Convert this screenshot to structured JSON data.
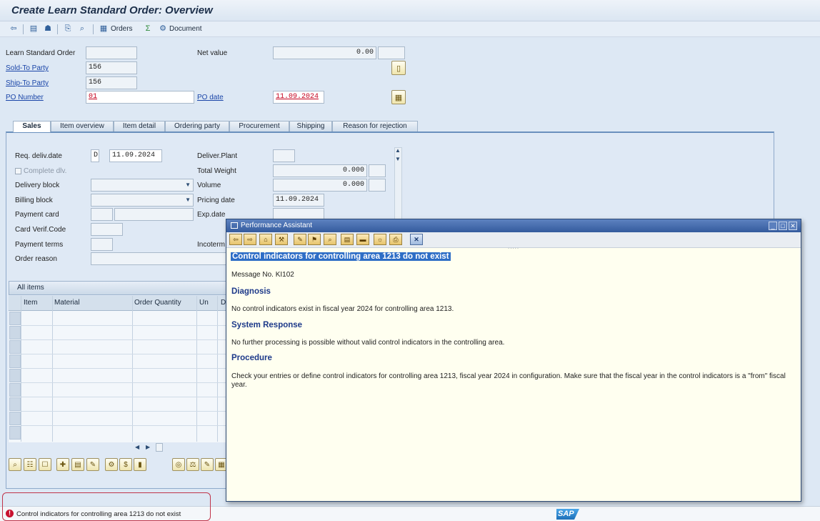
{
  "window": {
    "title": "Create Learn Standard Order: Overview"
  },
  "toolbar": {
    "orders_label": "Orders",
    "document_label": "Document"
  },
  "header": {
    "order_type_label": "Learn Standard Order",
    "sold_to_label": "Sold-To Party",
    "sold_to_value": "156",
    "ship_to_label": "Ship-To Party",
    "ship_to_value": "156",
    "po_number_label": "PO Number",
    "po_number_value": "01",
    "net_value_label": "Net value",
    "net_value": "0.00",
    "po_date_label": "PO date",
    "po_date_value": "11.09.2024"
  },
  "tabs": [
    "Sales",
    "Item overview",
    "Item detail",
    "Ordering party",
    "Procurement",
    "Shipping",
    "Reason for rejection"
  ],
  "sales_tab": {
    "req_deliv_date_label": "Req. deliv.date",
    "req_deliv_date_unit": "D",
    "req_deliv_date_value": "11.09.2024",
    "complete_dlv_label": "Complete dlv.",
    "delivery_block_label": "Delivery block",
    "billing_block_label": "Billing block",
    "payment_card_label": "Payment card",
    "card_verif_label": "Card Verif.Code",
    "payment_terms_label": "Payment terms",
    "order_reason_label": "Order reason",
    "deliver_plant_label": "Deliver.Plant",
    "total_weight_label": "Total Weight",
    "total_weight_value": "0.000",
    "volume_label": "Volume",
    "volume_value": "0.000",
    "pricing_date_label": "Pricing date",
    "pricing_date_value": "11.09.2024",
    "exp_date_label": "Exp.date",
    "incoterms_label": "Incoterm"
  },
  "items": {
    "title": "All items",
    "columns": [
      "Item",
      "Material",
      "Order Quantity",
      "Un",
      "D"
    ]
  },
  "status_bar": {
    "message": "Control indicators for controlling area 1213 do not exist"
  },
  "performance_assistant": {
    "window_title": "Performance Assistant",
    "title": "Control indicators for controlling area 1213 do not exist",
    "message_no": "Message No. KI102",
    "diagnosis_heading": "Diagnosis",
    "diagnosis_text": "No control indicators exist in fiscal year 2024 for controlling area 1213.",
    "system_response_heading": "System Response",
    "system_response_text": "No further processing is possible without valid control indicators in the controlling area.",
    "procedure_heading": "Procedure",
    "procedure_text": "Check your entries or define control indicators for controlling area 1213, fiscal year 2024 in configuration. Make sure that the fiscal year in the control indicators is a \"from\" fiscal year."
  },
  "colors": {
    "accent": "#2e6ec6",
    "error": "#c8102e",
    "dialog_bg": "#fffff0"
  }
}
